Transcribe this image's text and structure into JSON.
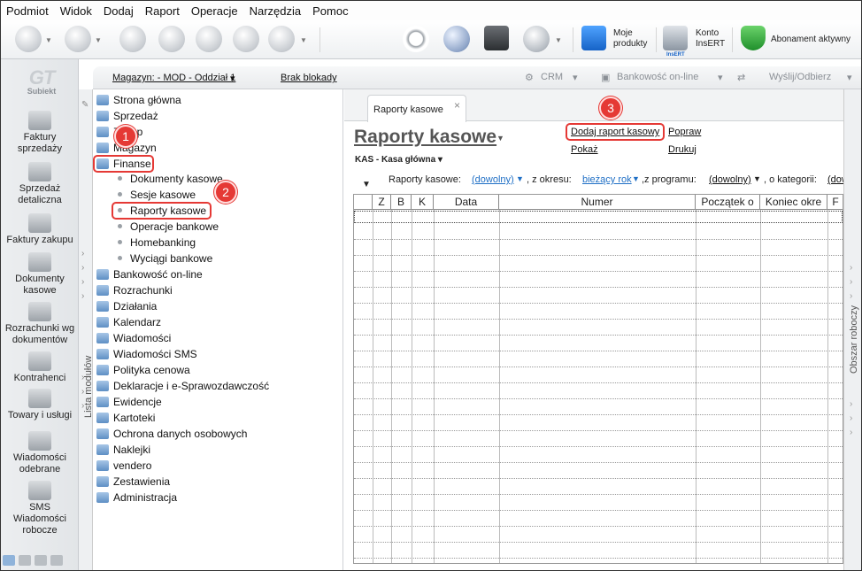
{
  "menu": [
    "Podmiot",
    "Widok",
    "Dodaj",
    "Raport",
    "Operacje",
    "Narzędzia",
    "Pomoc"
  ],
  "toolbar": {
    "moje_produkty": "Moje\nprodukty",
    "konto_insert_line1": "Konto",
    "konto_insert_line2": "InsERT",
    "insert_logo": "InsERT",
    "abonament": "Abonament aktywny"
  },
  "logo": {
    "big": "GT",
    "small": "Subiekt"
  },
  "left_nav": [
    {
      "label": "Faktury\nsprzedaży",
      "icon": "invoices-sales-icon"
    },
    {
      "label": "Sprzedaż\ndetaliczna",
      "icon": "retail-sale-icon"
    },
    {
      "label": "Faktury zakupu",
      "icon": "invoices-purchase-icon"
    },
    {
      "label": "Dokumenty\nkasowe",
      "icon": "cash-documents-icon"
    },
    {
      "label": "Rozrachunki wg\ndokumentów",
      "icon": "settlements-icon"
    },
    {
      "label": "Kontrahenci",
      "icon": "contractors-icon"
    },
    {
      "label": "Towary i usługi",
      "icon": "goods-services-icon"
    },
    {
      "label": "Wiadomości\nodebrane",
      "icon": "messages-received-icon"
    },
    {
      "label": "SMS\nWiadomości\nrobocze",
      "icon": "sms-drafts-icon"
    }
  ],
  "subbar": {
    "magazyn": "Magazyn: - MOD - Oddział 1",
    "blokady": "Brak blokady",
    "crm": "CRM",
    "bankowosc": "Bankowość on-line",
    "wyslij": "Wyślij/Odbierz"
  },
  "module_strip_label": "Lista modułów",
  "work_area_label": "Obszar roboczy",
  "tree": {
    "top": [
      "Strona główna",
      "Sprzedaż",
      "Zakup",
      "Magazyn",
      "Finanse"
    ],
    "finanse_children": [
      "Dokumenty kasowe",
      "Sesje kasowe",
      "Raporty kasowe",
      "Operacje bankowe",
      "Homebanking",
      "Wyciągi bankowe"
    ],
    "rest": [
      "Bankowość on-line",
      "Rozrachunki",
      "Działania",
      "Kalendarz",
      "Wiadomości",
      "Wiadomości SMS",
      "Polityka cenowa",
      "Deklaracje i e-Sprawozdawczość",
      "Ewidencje",
      "Kartoteki",
      "Ochrona danych osobowych",
      "Naklejki",
      "vendero",
      "Zestawienia",
      "Administracja"
    ]
  },
  "badges": {
    "b1": "1",
    "b2": "2",
    "b3": "3"
  },
  "main": {
    "tab_label": "Raporty kasowe",
    "tab_close": "×",
    "title": "Raporty kasowe",
    "title_dd": "▼",
    "kasa": "KAS - Kasa główna",
    "actions": {
      "add": "Dodaj raport kasowy",
      "popraw": "Popraw",
      "pokaz": "Pokaż",
      "drukuj": "Drukuj"
    },
    "filters": {
      "raporty_label": "Raporty kasowe:",
      "raporty_value": "(dowolny)",
      "okres_label": ", z okresu:",
      "okres_value": "bieżący rok",
      "program_label": ",z programu:",
      "program_value": "(dowolny)",
      "kategorii_label": ", o kategorii:",
      "kategorii_value": "(dow"
    },
    "columns": [
      "Z",
      "B",
      "K",
      "Data",
      "Numer",
      "Początek o",
      "Koniec okre",
      "F"
    ]
  }
}
